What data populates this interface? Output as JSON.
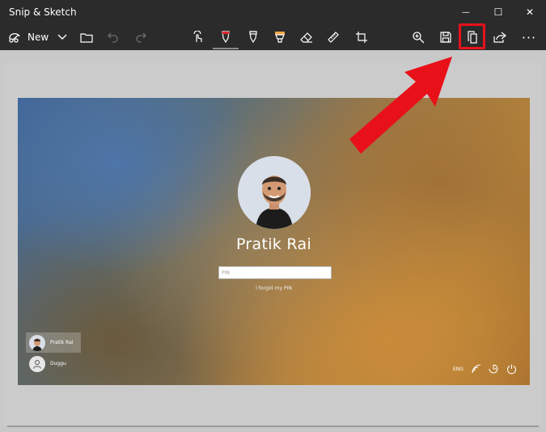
{
  "window": {
    "title": "Snip & Sketch",
    "minimize_glyph": "—",
    "maximize_glyph": "☐",
    "close_glyph": "✕"
  },
  "toolbar": {
    "new_label": "New",
    "icons": [
      "snip-icon",
      "chevron-down-icon",
      "folder-icon",
      "undo-icon",
      "redo-icon",
      "touch-writing-icon",
      "ballpoint-pen-icon",
      "pencil-icon",
      "highlighter-icon",
      "eraser-icon",
      "ruler-icon",
      "crop-icon",
      "zoom-icon",
      "save-icon",
      "copy-icon",
      "share-icon",
      "more-icon"
    ],
    "more_glyph": "···"
  },
  "lockscreen": {
    "user_name": "Pratik Rai",
    "pin_placeholder": "PIN",
    "forgot_link": "I forgot my PIN",
    "users": [
      {
        "label": "Pratik Rai",
        "selected": true
      },
      {
        "label": "Duggu",
        "selected": false
      }
    ],
    "language": "ENG"
  },
  "colors": {
    "titlebar_bg": "#2b2b2b",
    "canvas_bg": "#c8c8c8",
    "annotation_red": "#e8111a"
  }
}
